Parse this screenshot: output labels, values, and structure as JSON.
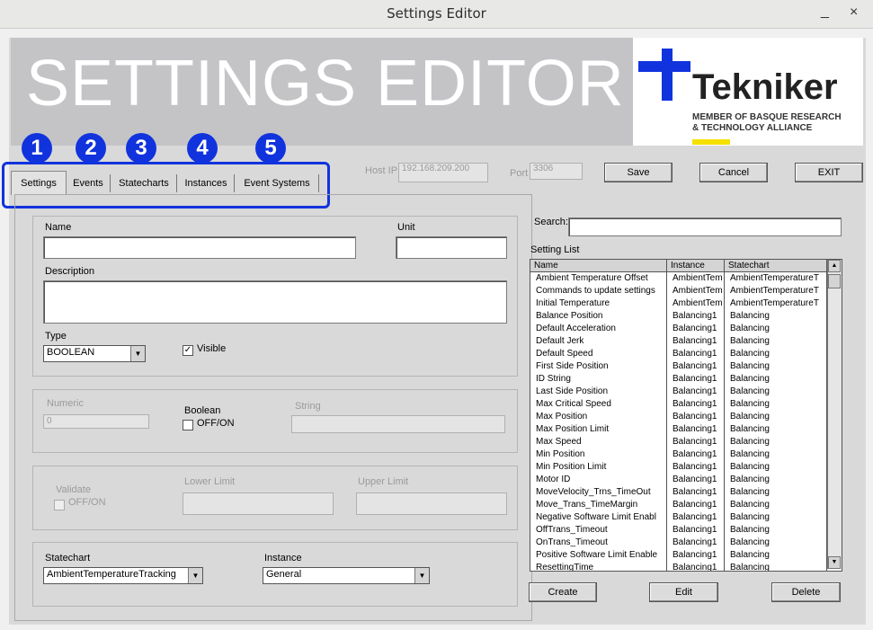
{
  "window": {
    "title": "Settings Editor",
    "minimize": "_",
    "close": "×"
  },
  "banner": {
    "title": "SETTINGS EDITOR"
  },
  "logo": {
    "name": "Tekniker",
    "line1": "MEMBER OF BASQUE RESEARCH",
    "line2": "& TECHNOLOGY ALLIANCE"
  },
  "markers": [
    "1",
    "2",
    "3",
    "4",
    "5"
  ],
  "tabs": [
    "Settings",
    "Events",
    "Statecharts",
    "Instances",
    "Event Systems"
  ],
  "connection": {
    "host_label": "Host IP",
    "host_value": "192.168.209.200",
    "port_label": "Port",
    "port_value": "3306"
  },
  "top_buttons": {
    "save": "Save",
    "cancel": "Cancel",
    "exit": "EXIT"
  },
  "form": {
    "name_label": "Name",
    "name_value": "",
    "unit_label": "Unit",
    "unit_value": "",
    "description_label": "Description",
    "description_value": "",
    "type_label": "Type",
    "type_value": "BOOLEAN",
    "visible_label": "Visible",
    "visible_checked": "✓",
    "numeric_label": "Numeric",
    "numeric_value": "0",
    "boolean_label": "Boolean",
    "boolean_option": "OFF/ON",
    "string_label": "String",
    "string_value": "",
    "validate_label": "Validate",
    "validate_option": "OFF/ON",
    "lower_label": "Lower Limit",
    "upper_label": "Upper Limit",
    "statechart_label": "Statechart",
    "statechart_value": "AmbientTemperatureTracking",
    "instance_label": "Instance",
    "instance_value": "General"
  },
  "search": {
    "label": "Search:",
    "value": ""
  },
  "settings_list": {
    "label": "Setting List",
    "columns": [
      "Name",
      "Instance",
      "Statechart"
    ],
    "rows": [
      [
        "Ambient Temperature Offset",
        "AmbientTem",
        "AmbientTemperatureT"
      ],
      [
        "Commands to update settings",
        "AmbientTem",
        "AmbientTemperatureT"
      ],
      [
        "Initial Temperature",
        "AmbientTem",
        "AmbientTemperatureT"
      ],
      [
        "Balance Position",
        "Balancing1",
        "Balancing"
      ],
      [
        "Default Acceleration",
        "Balancing1",
        "Balancing"
      ],
      [
        "Default Jerk",
        "Balancing1",
        "Balancing"
      ],
      [
        "Default Speed",
        "Balancing1",
        "Balancing"
      ],
      [
        "First Side Position",
        "Balancing1",
        "Balancing"
      ],
      [
        "ID String",
        "Balancing1",
        "Balancing"
      ],
      [
        "Last Side Position",
        "Balancing1",
        "Balancing"
      ],
      [
        "Max Critical Speed",
        "Balancing1",
        "Balancing"
      ],
      [
        "Max Position",
        "Balancing1",
        "Balancing"
      ],
      [
        "Max Position Limit",
        "Balancing1",
        "Balancing"
      ],
      [
        "Max Speed",
        "Balancing1",
        "Balancing"
      ],
      [
        "Min Position",
        "Balancing1",
        "Balancing"
      ],
      [
        "Min Position Limit",
        "Balancing1",
        "Balancing"
      ],
      [
        "Motor ID",
        "Balancing1",
        "Balancing"
      ],
      [
        "MoveVelocity_Trns_TimeOut",
        "Balancing1",
        "Balancing"
      ],
      [
        "Move_Trans_TimeMargin",
        "Balancing1",
        "Balancing"
      ],
      [
        "Negative Software Limit Enabl",
        "Balancing1",
        "Balancing"
      ],
      [
        "OffTrans_Timeout",
        "Balancing1",
        "Balancing"
      ],
      [
        "OnTrans_Timeout",
        "Balancing1",
        "Balancing"
      ],
      [
        "Positive Software Limit Enable",
        "Balancing1",
        "Balancing"
      ],
      [
        "ResettingTime",
        "Balancing1",
        "Balancing"
      ]
    ]
  },
  "bottom_buttons": {
    "create": "Create",
    "edit": "Edit",
    "delete": "Delete"
  },
  "colors": {
    "marker_blue": "#1133dd",
    "banner_gray": "#c4c4c7",
    "logo_yellow": "#f5e000"
  }
}
